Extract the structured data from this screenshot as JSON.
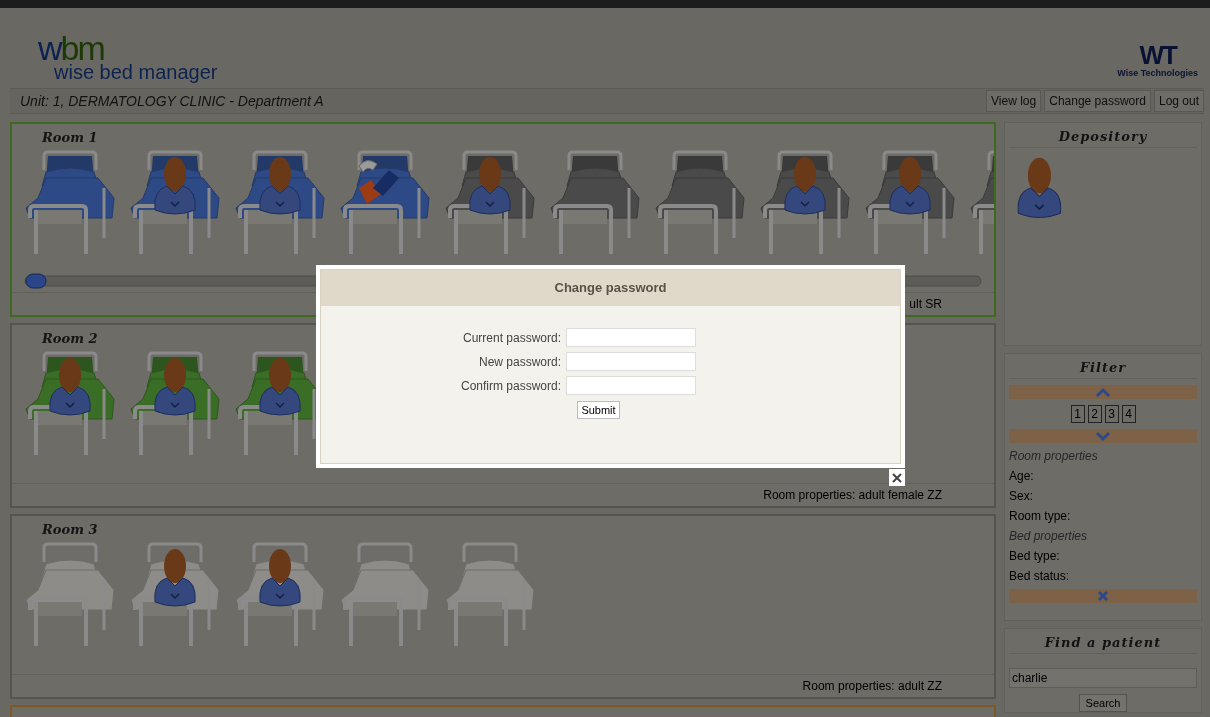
{
  "header": {
    "logo": {
      "mark_left": "w",
      "mark_right": "bm",
      "name": "wise bed manager"
    },
    "company_logo": {
      "mark": "WT",
      "name": "Wise Technologies"
    }
  },
  "unit": "Unit: 1, DERMATOLOGY CLINIC - Department A",
  "top_buttons": [
    "View log",
    "Change password",
    "Log out"
  ],
  "rooms": [
    {
      "title": "Room 1",
      "color": "#3d6a1e",
      "properties": "ult SR",
      "scrollable": true,
      "beds": [
        {
          "kind": "empty",
          "color": "#2d4a86"
        },
        {
          "kind": "patient",
          "color": "#2d4a86"
        },
        {
          "kind": "patient",
          "color": "#2d4a86"
        },
        {
          "kind": "repair",
          "color": "#2d4a86"
        },
        {
          "kind": "patient",
          "color": "#4a4a4a"
        },
        {
          "kind": "empty",
          "color": "#4a4a4a"
        },
        {
          "kind": "empty",
          "color": "#4a4a4a"
        },
        {
          "kind": "patient",
          "color": "#4a4a4a"
        },
        {
          "kind": "patient",
          "color": "#4a4a4a"
        },
        {
          "kind": "empty",
          "color": "#4a4a4a"
        }
      ]
    },
    {
      "title": "Room 2",
      "color": "#56544f",
      "properties": "Room properties: adult female ZZ",
      "scrollable": false,
      "beds": [
        {
          "kind": "patient",
          "color": "#3a6e26"
        },
        {
          "kind": "patient",
          "color": "#3a6e26"
        },
        {
          "kind": "patient",
          "color": "#3a6e26"
        }
      ]
    },
    {
      "title": "Room 3",
      "color": "#56544f",
      "properties": "Room properties: adult ZZ",
      "scrollable": false,
      "beds": [
        {
          "kind": "empty",
          "color": "#8e8c88"
        },
        {
          "kind": "patient",
          "color": "#8e8c88"
        },
        {
          "kind": "patient",
          "color": "#8e8c88"
        },
        {
          "kind": "empty",
          "color": "#8e8c88"
        },
        {
          "kind": "empty",
          "color": "#8e8c88"
        }
      ]
    },
    {
      "color": "#7e5a22",
      "scrollable": false
    }
  ],
  "depository": {
    "title": "Depository",
    "patients": [
      {
        "kind": "patient"
      }
    ]
  },
  "filter": {
    "title": "Filter",
    "pages": [
      "1",
      "2",
      "3",
      "4"
    ],
    "sections": [
      {
        "title": "Room properties",
        "fields": [
          "Age:",
          "Sex:",
          "Room type:"
        ]
      },
      {
        "title": "Bed properties",
        "fields": [
          "Bed type:",
          "Bed status:"
        ]
      }
    ]
  },
  "find_patient": {
    "title": "Find a patient",
    "value": "charlie",
    "button": "Search"
  },
  "dialog": {
    "title": "Change password",
    "fields": [
      {
        "label": "Current password:"
      },
      {
        "label": "New password:"
      },
      {
        "label": "Confirm password:"
      }
    ],
    "submit": "Submit"
  }
}
